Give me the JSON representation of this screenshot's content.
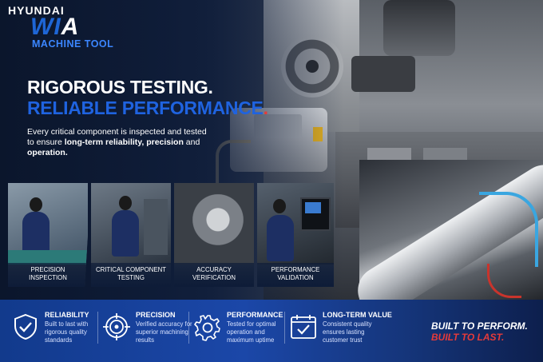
{
  "brand": {
    "line1": "HYUNDAI",
    "line2_a": "WI",
    "line2_b": "A",
    "line3": "MACHINE TOOL",
    "accent_color": "#1e66d6"
  },
  "headline": {
    "line1": "RIGOROUS TESTING.",
    "line2": "RELIABLE PERFORMANCE",
    "line2_punct": "."
  },
  "description": {
    "part1": "Every critical component is inspected and tested to ensure ",
    "bold1": "long-term reliability, precision",
    "part2": " and ",
    "bold2": "operation."
  },
  "cards": [
    {
      "label_1": "PRECISION",
      "label_2": "INSPECTION"
    },
    {
      "label_1": "CRITICAL COMPONENT",
      "label_2": "TESTING"
    },
    {
      "label_1": "ACCURACY",
      "label_2": "VERIFICATION"
    },
    {
      "label_1": "PERFORMANCE",
      "label_2": "VALIDATION"
    }
  ],
  "features": [
    {
      "title": "RELIABILITY",
      "desc": "Built to last with rigorous quality standards",
      "icon": "shield-check-icon"
    },
    {
      "title": "PRECISION",
      "desc": "Verified accuracy for superior machining results",
      "icon": "target-icon"
    },
    {
      "title": "PERFORMANCE",
      "desc": "Tested for optimal operation and maximum uptime",
      "icon": "gear-icon"
    },
    {
      "title": "LONG-TERM VALUE",
      "desc": "Consistent quality ensures lasting customer trust",
      "icon": "calendar-check-icon"
    }
  ],
  "slogan": {
    "line1": "BUILT TO PERFORM.",
    "line2": "BUILT TO LAST."
  },
  "colors": {
    "headline_blue": "#1f63e0",
    "accent_red": "#e63a3a",
    "band_blue": "#1b47a8"
  }
}
